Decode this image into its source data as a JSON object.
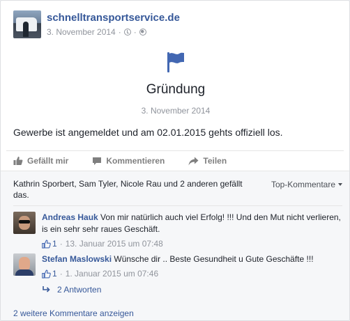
{
  "post": {
    "page_name": "schnelltransportservice.de",
    "date": "3. November 2014",
    "date_separator": "·",
    "text": "Gewerbe ist angemeldet und am 02.01.2015 gehts offiziell los."
  },
  "life_event": {
    "icon": "flag-icon",
    "title": "Gründung",
    "date": "3. November 2014"
  },
  "actions": {
    "like": "Gefällt mir",
    "comment": "Kommentieren",
    "share": "Teilen"
  },
  "likes_summary": "Kathrin Sporbert, Sam Tyler, Nicole Rau und 2 anderen gefällt das.",
  "top_comments_label": "Top-Kommentare",
  "comments": [
    {
      "author": "Andreas Hauk",
      "text": "Von mir natürlich auch viel Erfolg! !!! Und den Mut nicht verlieren, is ein sehr sehr raues Geschäft.",
      "like_count": "1",
      "separator": "·",
      "timestamp": "13. Januar 2015 um 07:48"
    },
    {
      "author": "Stefan Maslowski",
      "text": "Wünsche dir .. Beste Gesundheit u Gute Geschäfte !!!",
      "like_count": "1",
      "separator": "·",
      "timestamp": "1. Januar 2015 um 07:46"
    }
  ],
  "replies_label": "2 Antworten",
  "more_comments_label": "2 weitere Kommentare anzeigen",
  "colors": {
    "link_blue": "#365899",
    "flag_blue": "#4267b2",
    "muted_gray": "#90949c"
  }
}
